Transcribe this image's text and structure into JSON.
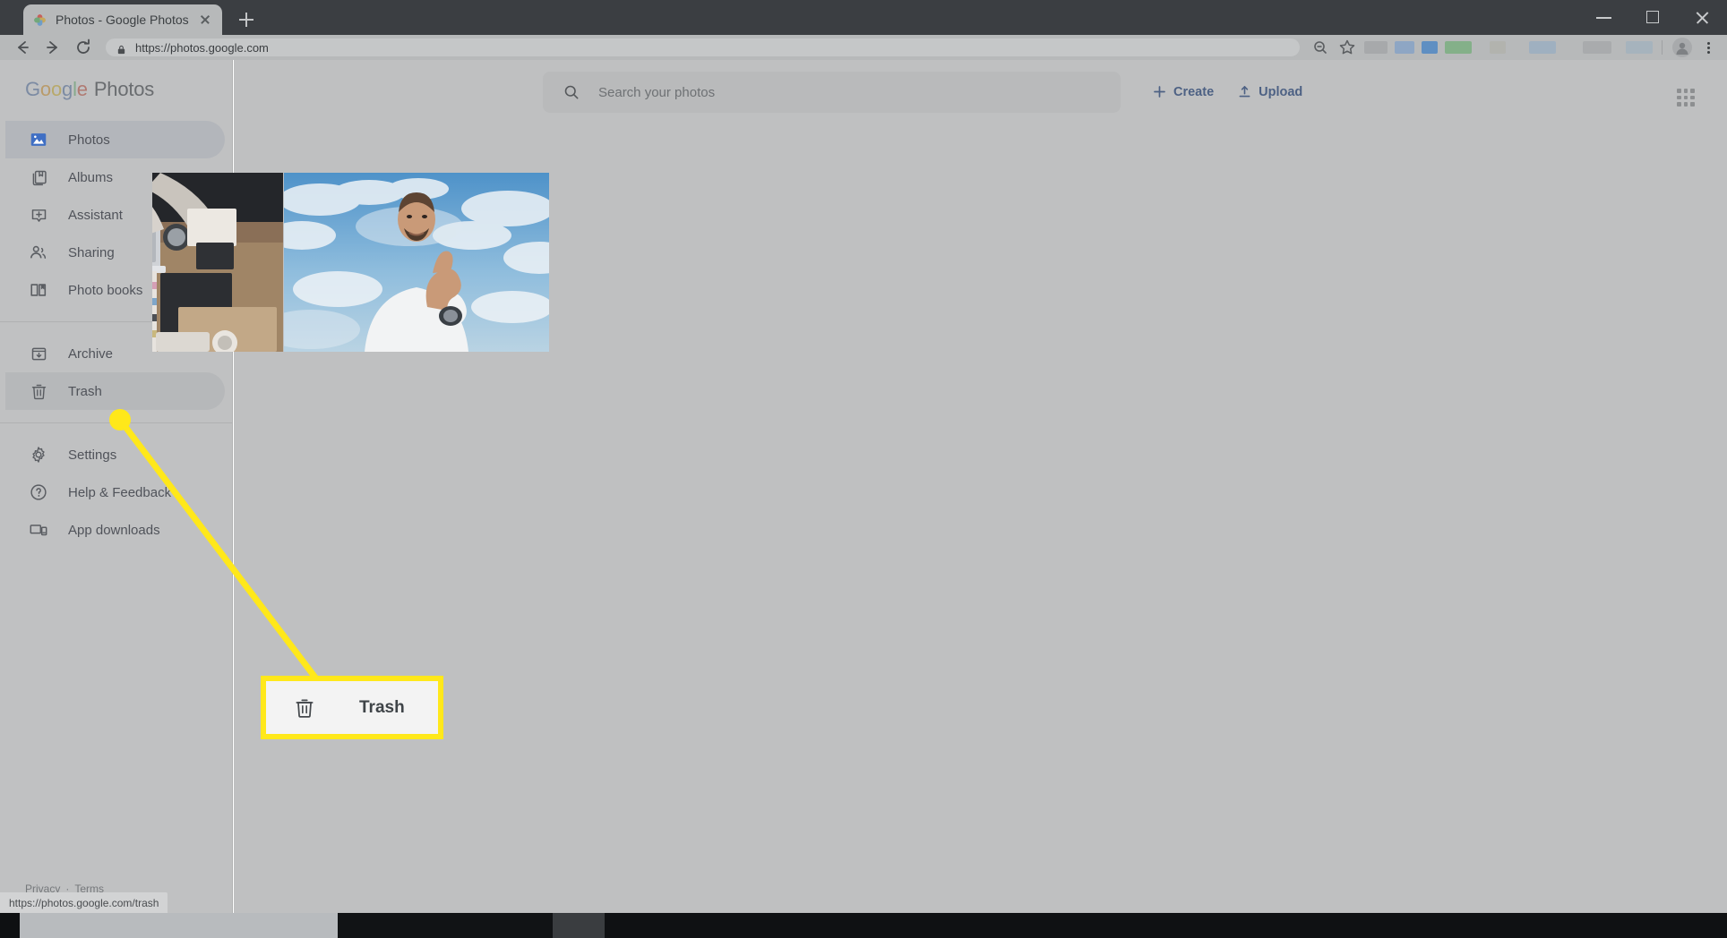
{
  "browser": {
    "tab": {
      "title": "Photos - Google Photos",
      "favicon": "google-photos-pinwheel-icon"
    },
    "new_tab_label": "+",
    "nav": {
      "back": "back-arrow-icon",
      "forward": "forward-arrow-icon",
      "reload": "reload-icon"
    },
    "url": "https://photos.google.com",
    "lock_icon": "lock-icon",
    "window_controls": {
      "minimize": "minimize-icon",
      "maximize": "maximize-icon",
      "close": "close-icon"
    },
    "right_icons": [
      "zoom-out-icon",
      "bookmark-star-icon",
      "extension-icon",
      "extension-icon",
      "extension-icon",
      "extension-icon",
      "profile-avatar",
      "chrome-menu-icon"
    ],
    "status_url": "https://photos.google.com/trash"
  },
  "app": {
    "brand": {
      "google_letters": [
        "G",
        "o",
        "o",
        "g",
        "l",
        "e"
      ],
      "product": "Photos"
    },
    "search": {
      "placeholder": "Search your photos",
      "icon": "search-icon"
    },
    "header_actions": [
      {
        "label": "Create",
        "icon": "plus-icon"
      },
      {
        "label": "Upload",
        "icon": "upload-icon"
      }
    ],
    "apps_grid_icon": "apps-grid-icon",
    "sidebar": {
      "groups": [
        {
          "items": [
            {
              "label": "Photos",
              "icon": "photo-image-icon",
              "state": "active"
            },
            {
              "label": "Albums",
              "icon": "albums-icon",
              "state": "normal"
            },
            {
              "label": "Assistant",
              "icon": "assistant-plus-icon",
              "state": "normal"
            },
            {
              "label": "Sharing",
              "icon": "sharing-people-icon",
              "state": "normal"
            },
            {
              "label": "Photo books",
              "icon": "photo-book-icon",
              "state": "normal"
            }
          ]
        },
        {
          "items": [
            {
              "label": "Archive",
              "icon": "archive-icon",
              "state": "normal"
            },
            {
              "label": "Trash",
              "icon": "trash-icon",
              "state": "hover"
            }
          ]
        },
        {
          "items": [
            {
              "label": "Settings",
              "icon": "gear-icon",
              "state": "normal"
            },
            {
              "label": "Help & Feedback",
              "icon": "help-circle-icon",
              "state": "normal"
            },
            {
              "label": "App downloads",
              "icon": "devices-icon",
              "state": "normal"
            }
          ]
        }
      ]
    },
    "footer": {
      "privacy": "Privacy",
      "separator": "·",
      "terms": "Terms"
    },
    "photos": [
      {
        "alt": "desk workspace with laptop and hands"
      },
      {
        "alt": "man giving thumbs up against cloudy sky"
      }
    ]
  },
  "annotation": {
    "callout": {
      "label": "Trash",
      "icon": "trash-icon"
    },
    "highlight_color": "#ffe81a",
    "dot": "annotation-dot"
  }
}
